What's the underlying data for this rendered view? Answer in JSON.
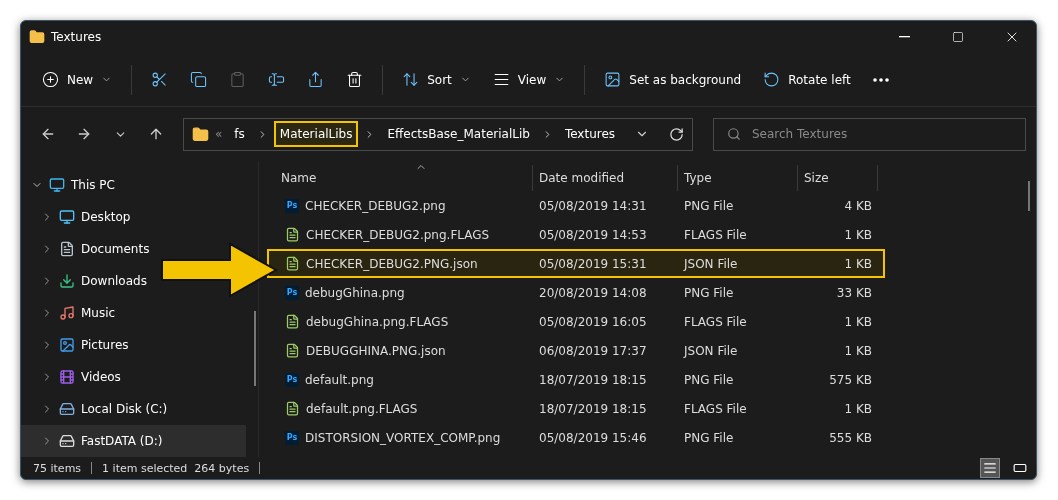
{
  "window": {
    "title": "Textures"
  },
  "toolbar": {
    "items": [
      {
        "kind": "new",
        "label": "New",
        "disabled": false
      },
      {
        "kind": "cut",
        "disabled": false
      },
      {
        "kind": "copy",
        "disabled": false
      },
      {
        "kind": "paste",
        "disabled": true
      },
      {
        "kind": "rename",
        "disabled": false
      },
      {
        "kind": "share",
        "disabled": false
      },
      {
        "kind": "delete",
        "disabled": false
      },
      {
        "kind": "sort",
        "label": "Sort",
        "disabled": false
      },
      {
        "kind": "view",
        "label": "View",
        "disabled": false
      },
      {
        "kind": "background",
        "label": "Set as background",
        "disabled": false
      },
      {
        "kind": "rotate",
        "label": "Rotate left",
        "disabled": false
      },
      {
        "kind": "more",
        "disabled": false
      }
    ]
  },
  "address": {
    "overflow": "«",
    "crumbs": [
      {
        "label": "fs",
        "highlighted": false
      },
      {
        "label": "MaterialLibs",
        "highlighted": true
      },
      {
        "label": "EffectsBase_MaterialLib",
        "highlighted": false
      },
      {
        "label": "Textures",
        "highlighted": false
      }
    ]
  },
  "search": {
    "placeholder": "Search Textures"
  },
  "sidebar": {
    "items": [
      {
        "label": "This PC",
        "kind": "pc",
        "expanded": true,
        "selected": false,
        "children": [
          {
            "label": "Desktop",
            "kind": "desktop",
            "expanded": false,
            "selected": false
          },
          {
            "label": "Documents",
            "kind": "documents",
            "expanded": false,
            "selected": false
          },
          {
            "label": "Downloads",
            "kind": "downloads",
            "expanded": false,
            "selected": false
          },
          {
            "label": "Music",
            "kind": "music",
            "expanded": false,
            "selected": false
          },
          {
            "label": "Pictures",
            "kind": "pictures",
            "expanded": false,
            "selected": false
          },
          {
            "label": "Videos",
            "kind": "videos",
            "expanded": false,
            "selected": false
          },
          {
            "label": "Local Disk (C:)",
            "kind": "disk",
            "expanded": false,
            "selected": false
          },
          {
            "label": "FastDATA (D:)",
            "kind": "drive",
            "expanded": false,
            "selected": true
          }
        ]
      }
    ]
  },
  "table": {
    "columns": [
      "Name",
      "Date modified",
      "Type",
      "Size"
    ],
    "rows": [
      {
        "kind": "image",
        "badge": "Ps",
        "name": "CHECKER_DEBUG2.png",
        "date": "05/08/2019 14:31",
        "type": "PNG File",
        "size": "4 KB",
        "highlighted": false
      },
      {
        "kind": "text",
        "name": "CHECKER_DEBUG2.png.FLAGS",
        "date": "05/08/2019 14:53",
        "type": "FLAGS File",
        "size": "1 KB",
        "highlighted": false
      },
      {
        "kind": "text",
        "name": "CHECKER_DEBUG2.PNG.json",
        "date": "05/08/2019 15:31",
        "type": "JSON File",
        "size": "1 KB",
        "highlighted": true
      },
      {
        "kind": "image",
        "badge": "Ps",
        "name": "debugGhina.png",
        "date": "20/08/2019 14:08",
        "type": "PNG File",
        "size": "33 KB",
        "highlighted": false
      },
      {
        "kind": "text",
        "name": "debugGhina.png.FLAGS",
        "date": "05/08/2019 16:05",
        "type": "FLAGS File",
        "size": "1 KB",
        "highlighted": false
      },
      {
        "kind": "text",
        "name": "DEBUGGHINA.PNG.json",
        "date": "06/08/2019 17:37",
        "type": "JSON File",
        "size": "1 KB",
        "highlighted": false
      },
      {
        "kind": "image",
        "badge": "Ps",
        "name": "default.png",
        "date": "18/07/2019 18:15",
        "type": "PNG File",
        "size": "575 KB",
        "highlighted": false
      },
      {
        "kind": "text",
        "name": "default.png.FLAGS",
        "date": "18/07/2019 18:15",
        "type": "FLAGS File",
        "size": "1 KB",
        "highlighted": false
      },
      {
        "kind": "image",
        "badge": "Ps",
        "name": "DISTORSION_VORTEX_COMP.png",
        "date": "05/08/2019 15:46",
        "type": "PNG File",
        "size": "555 KB",
        "highlighted": false
      }
    ]
  },
  "status_bar": {
    "count": "75 items",
    "selection": "1 item selected  264 bytes",
    "views": [
      {
        "kind": "details",
        "selected": true
      },
      {
        "kind": "tiles",
        "selected": false
      }
    ]
  }
}
